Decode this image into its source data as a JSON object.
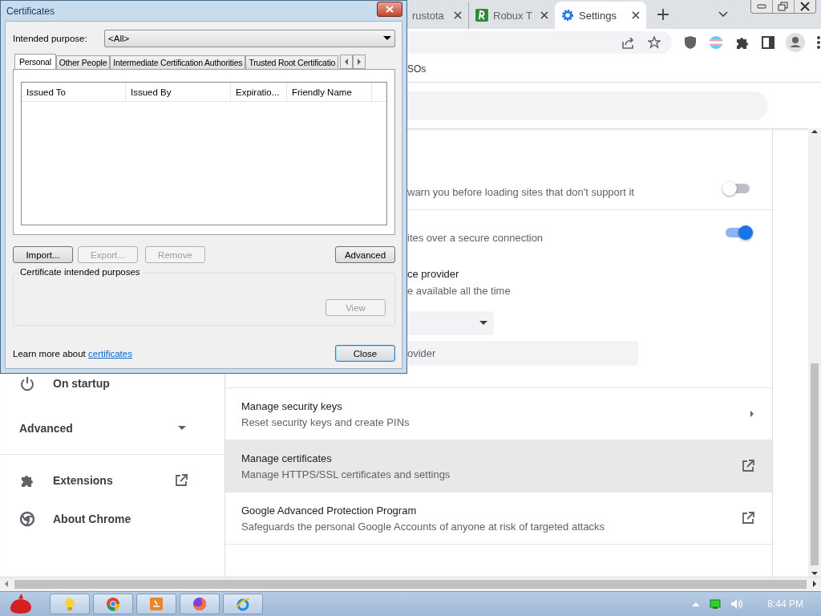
{
  "browser": {
    "tabs": [
      {
        "title": "rustota",
        "kind": "plain",
        "selected": false
      },
      {
        "title": "Robux T",
        "kind": "site",
        "selected": false
      },
      {
        "title": "Settings",
        "kind": "settings",
        "selected": true
      }
    ],
    "bookmarks": [
      "SOs"
    ],
    "sidebar": [
      {
        "label": "On startup",
        "kind": "power"
      },
      {
        "label": "Advanced",
        "kind": "heading"
      },
      {
        "label": "Extensions",
        "kind": "extensions"
      },
      {
        "label": "About Chrome",
        "kind": "about"
      }
    ],
    "toggle_rows": [
      {
        "description": "warn you before loading sites that don't support it",
        "on": false
      },
      {
        "description": "ites over a secure connection",
        "on": true
      }
    ],
    "provider": {
      "title": "ce provider",
      "description": "e available all the time",
      "field_value": "ovider"
    },
    "link_rows": [
      {
        "title": "Manage security keys",
        "subtitle": "Reset security keys and create PINs",
        "kind": "arrow",
        "highlighted": false
      },
      {
        "title": "Manage certificates",
        "subtitle": "Manage HTTPS/SSL certificates and settings",
        "kind": "external",
        "highlighted": true
      },
      {
        "title": "Google Advanced Protection Program",
        "subtitle": "Safeguards the personal Google Accounts of anyone at risk of targeted attacks",
        "kind": "external",
        "highlighted": false
      }
    ]
  },
  "dialog": {
    "title": "Certificates",
    "purpose_label": "Intended purpose:",
    "purpose_value": "<All>",
    "tabs": [
      {
        "label": "Personal",
        "selected": true
      },
      {
        "label": "Other People",
        "selected": false
      },
      {
        "label": "Intermediate Certification Authorities",
        "selected": false
      },
      {
        "label": "Trusted Root Certificatio",
        "selected": false
      }
    ],
    "columns": [
      "Issued To",
      "Issued By",
      "Expiratio...",
      "Friendly Name"
    ],
    "buttons": [
      {
        "label": "Import...",
        "disabled": false
      },
      {
        "label": "Export...",
        "disabled": true
      },
      {
        "label": "Remove",
        "disabled": true
      }
    ],
    "advanced_button": "Advanced",
    "group_title": "Certificate intended purposes",
    "view_button": {
      "label": "View",
      "disabled": true
    },
    "footer_text": "Learn more about",
    "footer_link": "certificates",
    "close_button": "Close"
  },
  "taskbar": {
    "clock": "8:44 PM"
  }
}
